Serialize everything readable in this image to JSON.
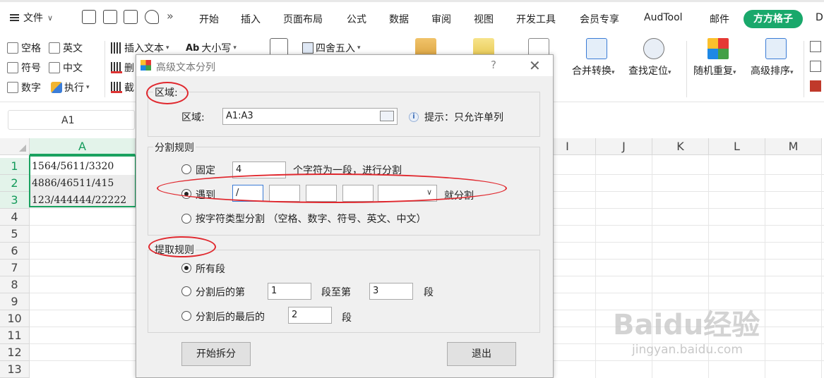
{
  "menubar": {
    "file": "文件",
    "tabs": [
      "开始",
      "插入",
      "页面布局",
      "公式",
      "数据",
      "审阅",
      "视图",
      "开发工具",
      "会员专享",
      "AudTool",
      "邮件"
    ],
    "active_tab": "方方格子",
    "overflow_tab": "D"
  },
  "ribbon": {
    "checkboxes": [
      "空格",
      "英文",
      "符号",
      "中文",
      "数字"
    ],
    "execute": "执行",
    "insert_text": "插入文本",
    "delete_prefix": "删",
    "truncate_prefix": "截",
    "case": "大小写",
    "round": "四舍五入",
    "merge_convert": "合并转换",
    "find_locate": "查找定位",
    "random_repeat": "随机重复",
    "advanced_sort": "高级排序",
    "accent_color": "#19a86b"
  },
  "namebox": {
    "value": "A1"
  },
  "sheet": {
    "columns": [
      "A",
      "I",
      "J",
      "K",
      "L",
      "M"
    ],
    "rows": [
      "1",
      "2",
      "3",
      "4",
      "5",
      "6",
      "7",
      "8",
      "9",
      "10",
      "11",
      "12",
      "13"
    ],
    "cells": [
      "1564/5611/3320",
      "4886/46511/415",
      "123/444444/22222"
    ]
  },
  "dialog": {
    "title": "高级文本分列",
    "help": "?",
    "close": "✕",
    "region": {
      "group": "区域:",
      "label": "区域:",
      "value": "A1:A3",
      "hint": "提示：只允许单列"
    },
    "split": {
      "group": "分割规则",
      "fixed_label": "固定",
      "fixed_value": "4",
      "fixed_suffix": "个字符为一段，进行分割",
      "meet_label": "遇到",
      "meet_values": [
        "/",
        "",
        "",
        ""
      ],
      "meet_suffix": "就分割",
      "type_label": "按字符类型分割 （空格、数字、符号、英文、中文）",
      "selected": "meet"
    },
    "extract": {
      "group": "提取规则",
      "all_label": "所有段",
      "after_label": "分割后的第",
      "from_value": "1",
      "mid_label": "段至第",
      "to_value": "3",
      "seg_label": "段",
      "last_label": "分割后的最后的",
      "last_value": "2",
      "last_seg_label": "段",
      "selected": "all"
    },
    "start_button": "开始拆分",
    "exit_button": "退出"
  },
  "watermark": {
    "brand": "Baidu经验",
    "url": "jingyan.baidu.com"
  },
  "colors": {
    "selection_green": "#1aa260",
    "annotation_red": "#e0282e"
  }
}
